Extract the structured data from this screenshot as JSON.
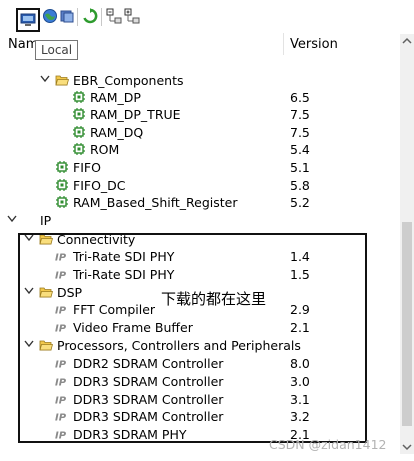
{
  "tooltip": "Local",
  "columns": {
    "name": "Nam",
    "version": "Version"
  },
  "toolbar": [
    {
      "name": "local-icon",
      "active": true
    },
    {
      "name": "network-icon"
    },
    {
      "name": "library-icon"
    },
    {
      "name": "refresh-icon"
    },
    {
      "name": "collapse-icon"
    },
    {
      "name": "expand-icon"
    }
  ],
  "rows": [
    {
      "label": "EBR_Components",
      "type": "folder",
      "depth": 1,
      "expanded": true,
      "version": ""
    },
    {
      "label": "RAM_DP",
      "type": "core",
      "depth": 2,
      "version": "6.5"
    },
    {
      "label": "RAM_DP_TRUE",
      "type": "core",
      "depth": 2,
      "version": "7.5"
    },
    {
      "label": "RAM_DQ",
      "type": "core",
      "depth": 2,
      "version": "7.5"
    },
    {
      "label": "ROM",
      "type": "core",
      "depth": 2,
      "version": "5.4"
    },
    {
      "label": "FIFO",
      "type": "core",
      "depth": 1,
      "version": "5.1"
    },
    {
      "label": "FIFO_DC",
      "type": "core",
      "depth": 1,
      "version": "5.8"
    },
    {
      "label": "RAM_Based_Shift_Register",
      "type": "core",
      "depth": 1,
      "version": "5.2"
    },
    {
      "label": "IP",
      "type": "root",
      "depth": 0,
      "expanded": true,
      "version": ""
    },
    {
      "label": "Connectivity",
      "type": "folder",
      "depth": 1,
      "expanded": true,
      "version": ""
    },
    {
      "label": "Tri-Rate SDI PHY",
      "type": "ip",
      "depth": 2,
      "version": "1.4"
    },
    {
      "label": "Tri-Rate SDI PHY",
      "type": "ip",
      "depth": 2,
      "version": "1.5"
    },
    {
      "label": "DSP",
      "type": "folder",
      "depth": 1,
      "expanded": true,
      "version": ""
    },
    {
      "label": "FFT Compiler",
      "type": "ip",
      "depth": 2,
      "version": "2.9"
    },
    {
      "label": "Video Frame Buffer",
      "type": "ip",
      "depth": 2,
      "version": "2.1"
    },
    {
      "label": "Processors, Controllers and Peripherals",
      "type": "folder",
      "depth": 1,
      "expanded": true,
      "version": ""
    },
    {
      "label": "DDR2 SDRAM Controller",
      "type": "ip",
      "depth": 2,
      "version": "8.0"
    },
    {
      "label": "DDR3 SDRAM Controller",
      "type": "ip",
      "depth": 2,
      "version": "3.0"
    },
    {
      "label": "DDR3 SDRAM Controller",
      "type": "ip",
      "depth": 2,
      "version": "3.1"
    },
    {
      "label": "DDR3 SDRAM Controller",
      "type": "ip",
      "depth": 2,
      "version": "3.2"
    },
    {
      "label": "DDR3 SDRAM PHY",
      "type": "ip",
      "depth": 2,
      "version": "2.1"
    }
  ],
  "annotation": "下载的都在这里",
  "watermark": "CSDN @zidan1412",
  "colors": {
    "folder": "#f2c84b",
    "core": "#2f8c2f",
    "ip": "#8a8a8a",
    "refresh": "#2e9b2e",
    "accent": "#2a5db0"
  }
}
